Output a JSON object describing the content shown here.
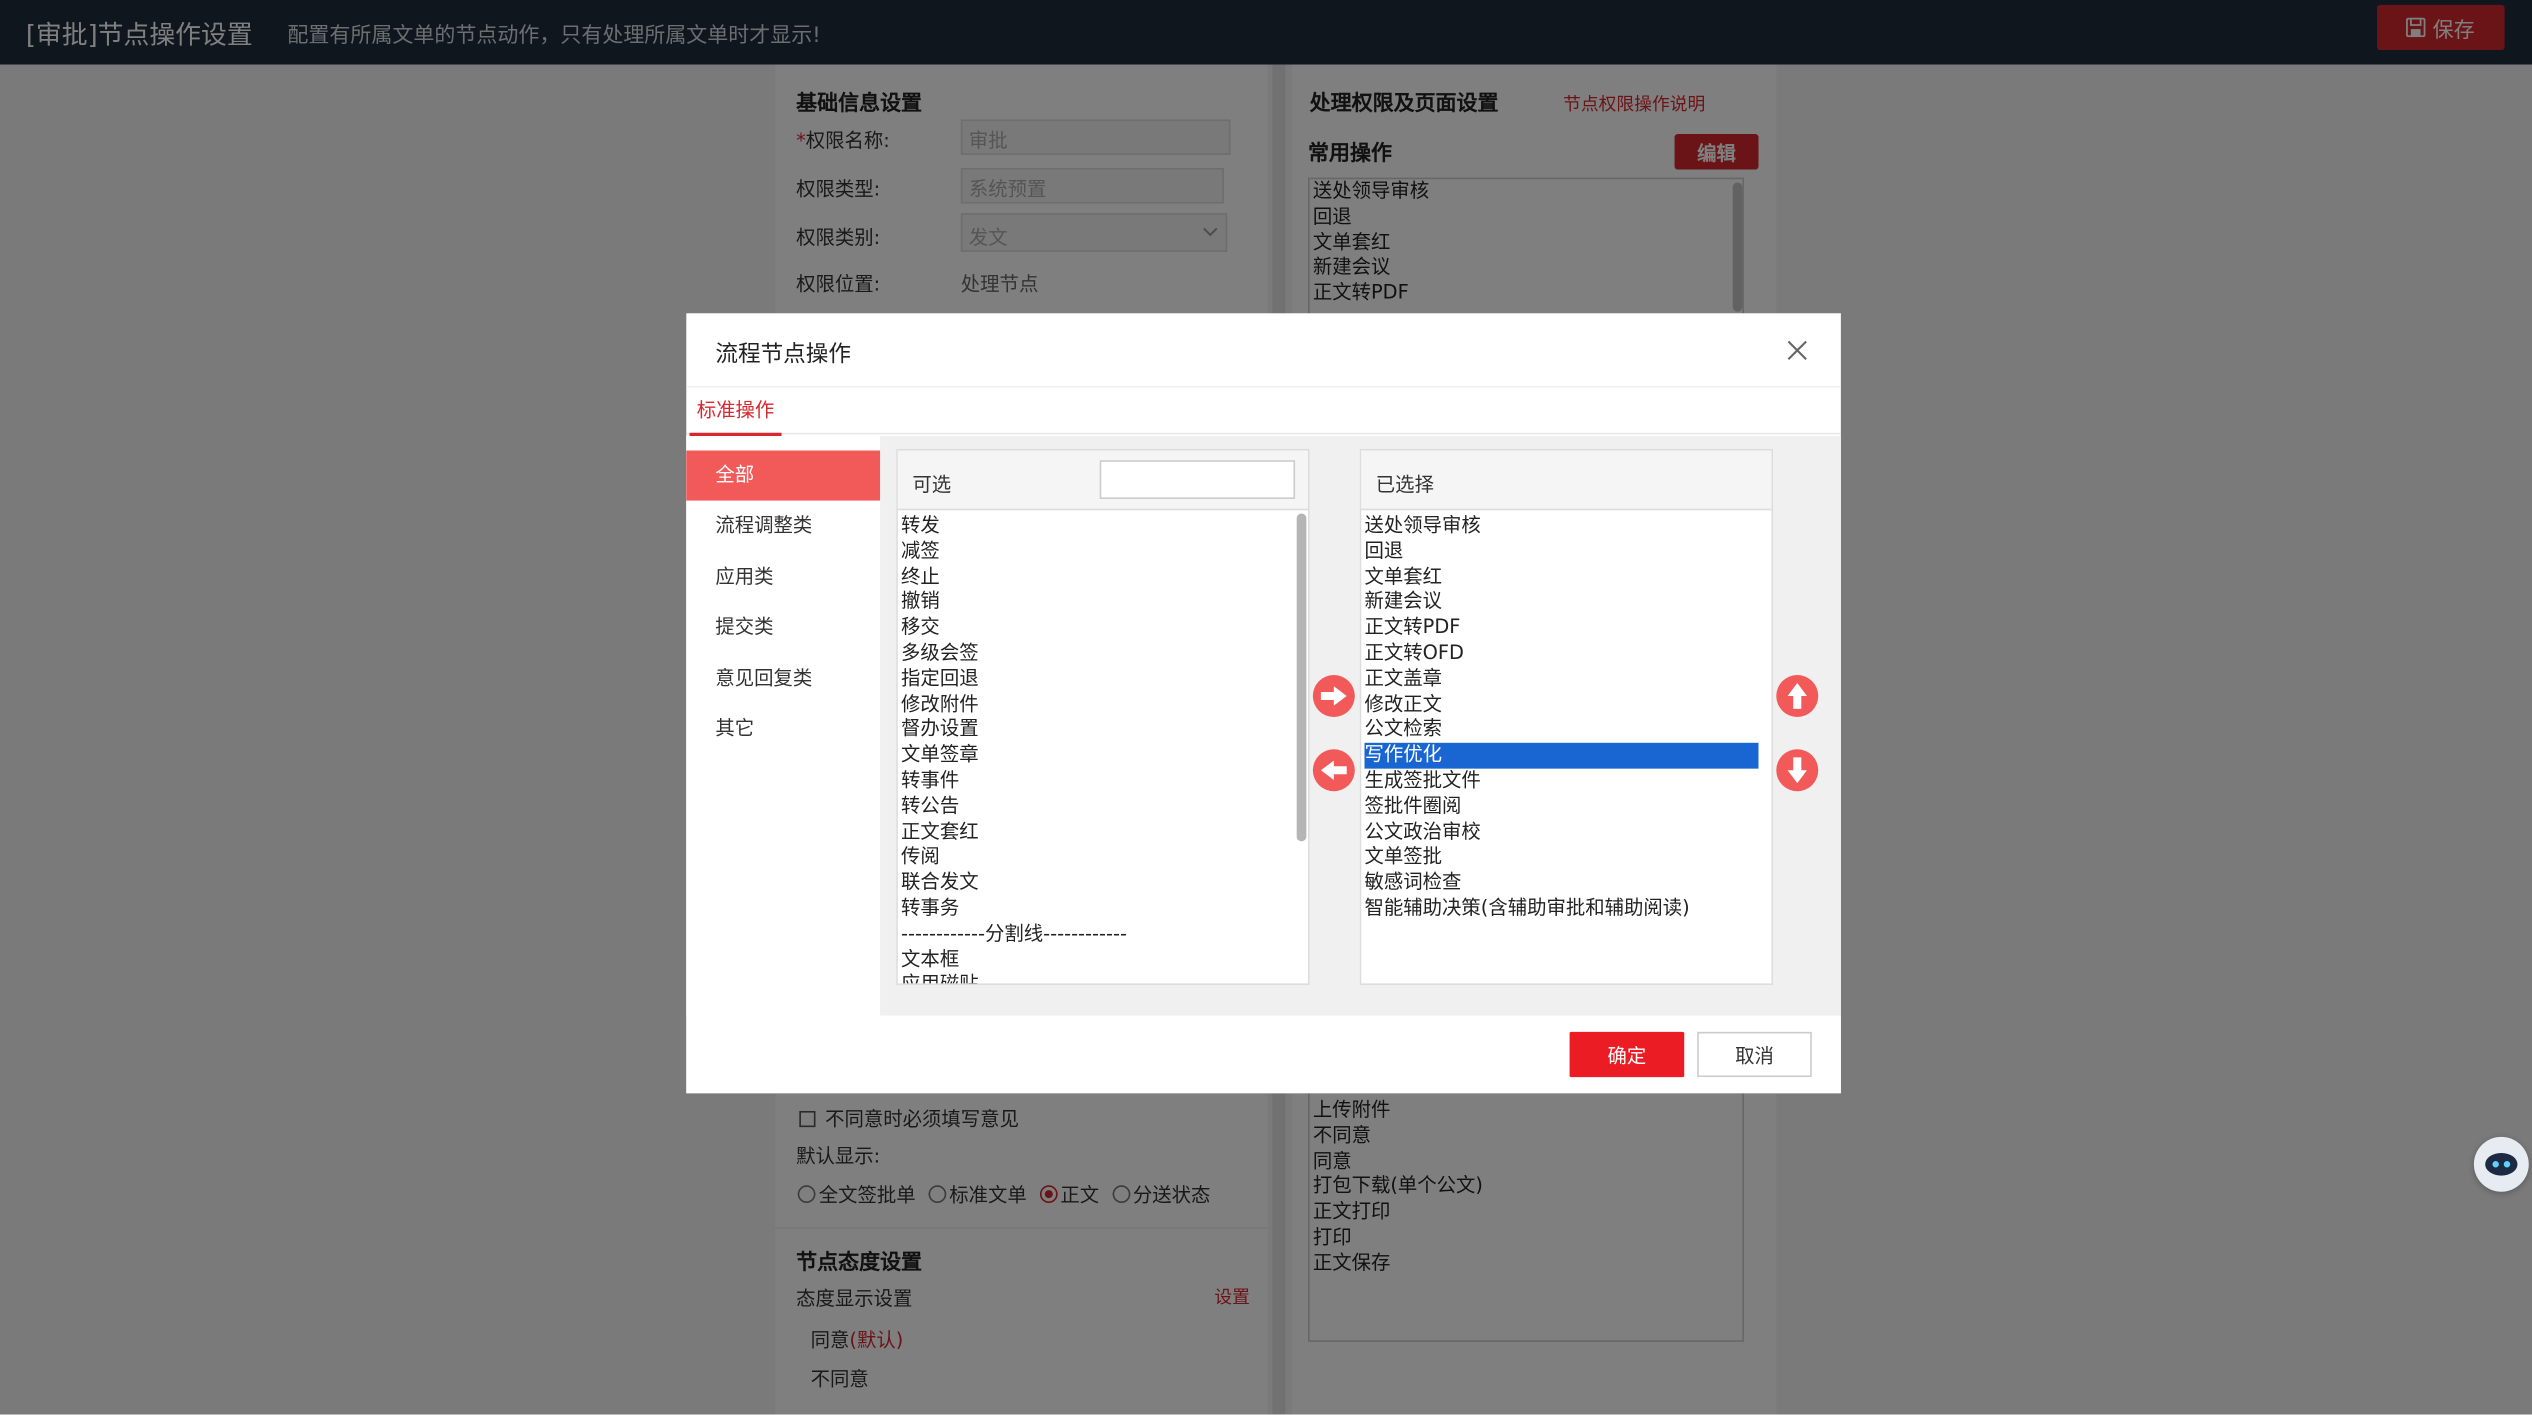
{
  "header": {
    "title": "[审批]节点操作设置",
    "subtitle": "配置有所属文单的节点动作，只有处理所属文单时才显示!",
    "save_label": "保存"
  },
  "basic": {
    "section_title": "基础信息设置",
    "required_mark": "*",
    "name_label": "权限名称:",
    "name_value": "审批",
    "type_label": "权限类型:",
    "type_value": "系统预置",
    "category_label": "权限类别:",
    "category_value": "发文",
    "position_label": "权限位置:",
    "position_value": "处理节点"
  },
  "below_modal_left": {
    "disagree_required": "不同意时必须填写意见",
    "default_display_label": "默认显示:",
    "display_options": [
      "全文签批单",
      "标准文单",
      "正文",
      "分送状态"
    ],
    "display_selected": "正文",
    "attitude_title": "节点态度设置",
    "attitude_display_label": "态度显示设置",
    "attitude_set_link": "设置",
    "attitude_agree": "同意",
    "attitude_default_tag": "(默认)",
    "attitude_disagree": "不同意"
  },
  "rights": {
    "section_title": "处理权限及页面设置",
    "help_link": "节点权限操作说明",
    "common_ops_title": "常用操作",
    "edit_label": "编辑",
    "common_ops_top": [
      "送处领导审核",
      "回退",
      "文单套红",
      "新建会议",
      "正文转PDF"
    ],
    "common_ops_bottom": [
      "上传附件",
      "不同意",
      "同意",
      "打包下载(单个公文)",
      "正文打印",
      "打印",
      "正文保存"
    ]
  },
  "modal": {
    "title": "流程节点操作",
    "tab_label": "标准操作",
    "categories": [
      "全部",
      "流程调整类",
      "应用类",
      "提交类",
      "意见回复类",
      "其它"
    ],
    "active_category": "全部",
    "available_label": "可选",
    "search_value": "",
    "available_items": [
      "转发",
      "减签",
      "终止",
      "撤销",
      "移交",
      "多级会签",
      "指定回退",
      "修改附件",
      "督办设置",
      "文单签章",
      "转事件",
      "转公告",
      "正文套红",
      "传阅",
      "联合发文",
      "转事务",
      "------------分割线------------",
      "文本框",
      "应用磁贴"
    ],
    "selected_label": "已选择",
    "selected_items": [
      "送处领导审核",
      "回退",
      "文单套红",
      "新建会议",
      "正文转PDF",
      "正文转OFD",
      "正文盖章",
      "修改正文",
      "公文检索",
      "写作优化",
      "生成签批文件",
      "签批件圈阅",
      "公文政治审校",
      "文单签批",
      "敏感词检查",
      "智能辅助决策(含辅助审批和辅助阅读)"
    ],
    "highlighted_item": "写作优化",
    "ok_label": "确定",
    "cancel_label": "取消"
  },
  "colors": {
    "brand_red": "#d7282f",
    "accent_red": "#f25a5a",
    "selection_blue": "#1966d2",
    "header_bg": "#1f2d3d"
  }
}
